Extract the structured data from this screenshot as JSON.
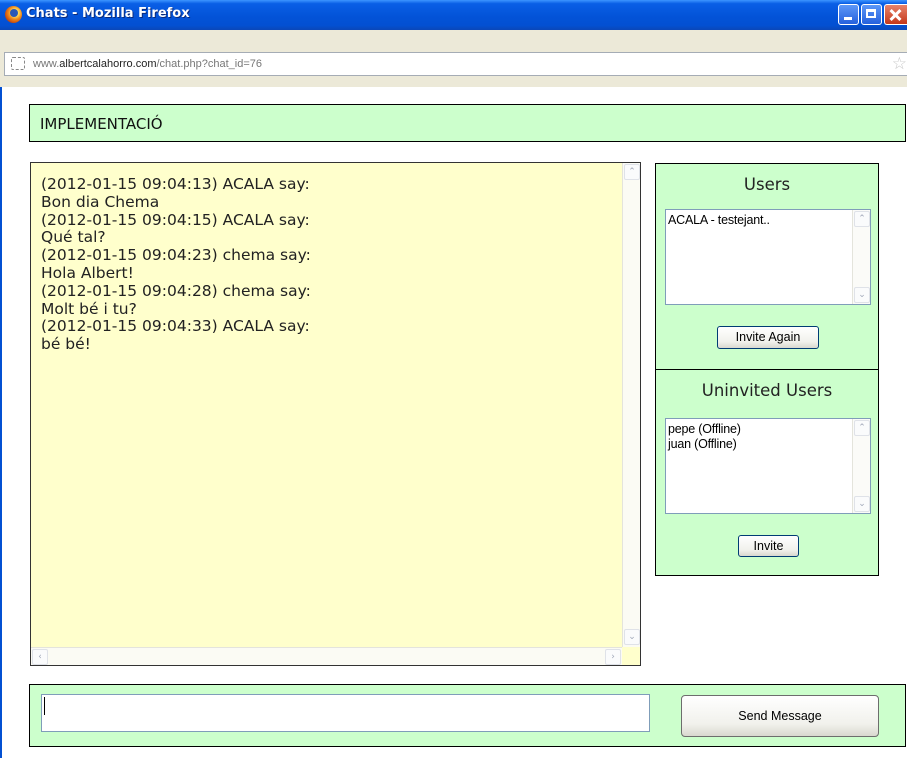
{
  "window": {
    "title": "Chats - Mozilla Firefox"
  },
  "address_bar": {
    "url_prefix": "www.",
    "url_domain": "albertcalahorro.com",
    "url_path": "/chat.php?chat_id=76"
  },
  "header": {
    "title": "IMPLEMENTACIÓ"
  },
  "chat": {
    "lines": [
      "(2012-01-15 09:04:13) ACALA say:",
      "Bon dia Chema",
      "(2012-01-15 09:04:15) ACALA say:",
      "Qué tal?",
      "(2012-01-15 09:04:23) chema say:",
      "Hola Albert!",
      "(2012-01-15 09:04:28) chema say:",
      "Molt bé i tu?",
      "(2012-01-15 09:04:33) ACALA say:",
      "bé bé!"
    ]
  },
  "users_panel": {
    "heading": "Users",
    "items": [
      "ACALA - testejant.."
    ],
    "button_label": "Invite Again"
  },
  "uninvited_panel": {
    "heading": "Uninvited Users",
    "items": [
      "pepe (Offline)",
      "juan (Offline)"
    ],
    "button_label": "Invite"
  },
  "composer": {
    "value": "",
    "send_label": "Send Message"
  },
  "colors": {
    "panel_green": "#ccffcc",
    "chat_yellow": "#ffffcc",
    "titlebar_blue": "#0353d8"
  }
}
